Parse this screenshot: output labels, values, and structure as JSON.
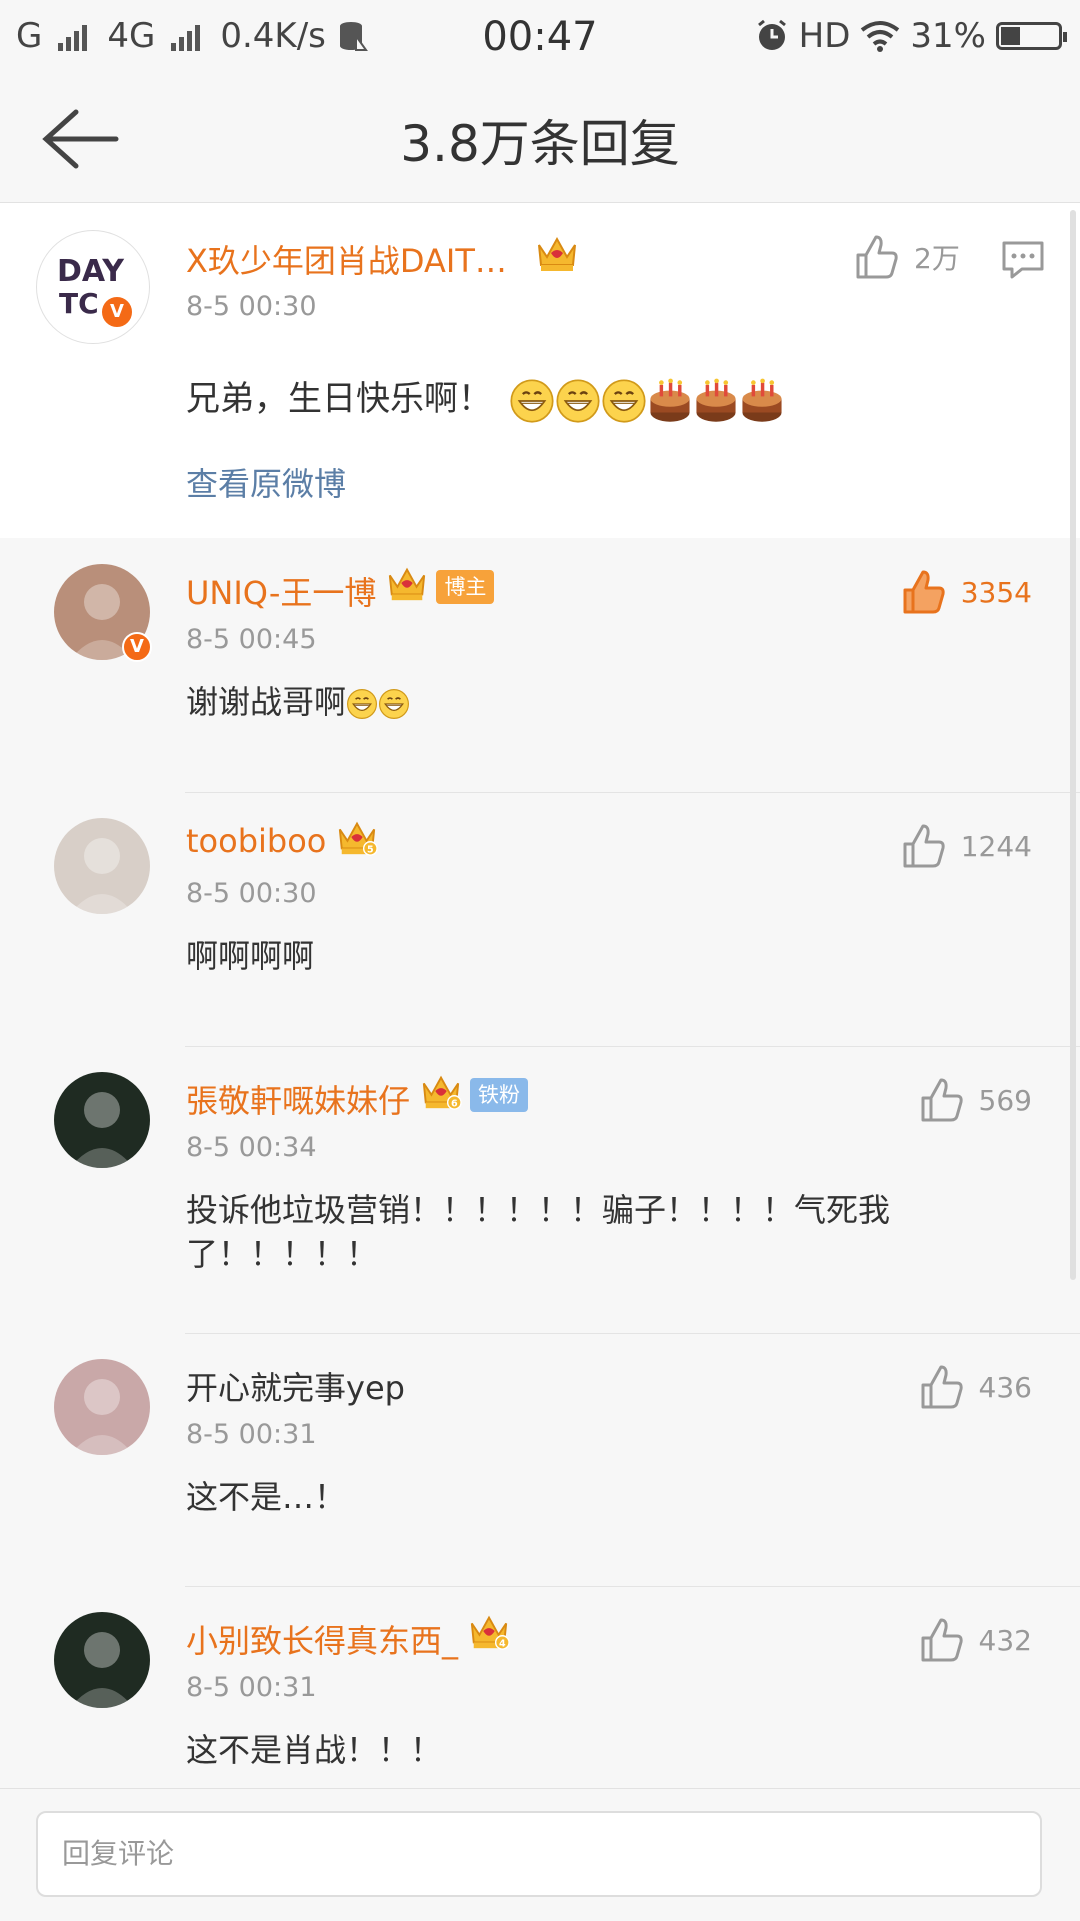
{
  "status_bar": {
    "carrier": "G",
    "network": "4G",
    "speed": "0.4K/s",
    "time": "00:47",
    "hd": "HD",
    "battery": "31%",
    "battery_level": 0.31
  },
  "header": {
    "title": "3.8万条回复",
    "back_icon": "back-arrow-icon"
  },
  "root_comment": {
    "username": "X玖少年团肖战DAIT…",
    "time": "8-5 00:30",
    "text": "兄弟，生日快乐啊！",
    "emojis": [
      "grin",
      "grin",
      "grin",
      "cake",
      "cake",
      "cake"
    ],
    "likes": "2万",
    "view_original": "查看原微博"
  },
  "comments": [
    {
      "username": "UNIQ-王一博",
      "tag": "博主",
      "time": "8-5 00:45",
      "text": "谢谢战哥啊",
      "likes": "3354"
    },
    {
      "username": "toobiboo",
      "time": "8-5 00:30",
      "text": "啊啊啊啊",
      "likes": "1244"
    },
    {
      "username": "張敬軒嘅妹妹仔",
      "tag": "铁粉",
      "time": "8-5 00:34",
      "text": "投诉他垃圾营销！！！！！！骗子！！！！气死我",
      "text2": "了！！！！！",
      "likes": "569"
    },
    {
      "username": "开心就完事yep",
      "time": "8-5 00:31",
      "text": "这不是…！",
      "likes": "436"
    },
    {
      "username": "小别致长得真东西_",
      "time": "8-5 00:31",
      "text": "这不是肖战！！！",
      "likes": "432"
    }
  ],
  "reply_bar": {
    "placeholder": "回复评论"
  },
  "colors": {
    "accent": "#e8731d",
    "link": "#5b7ea6",
    "crown": "#f5b82e"
  }
}
